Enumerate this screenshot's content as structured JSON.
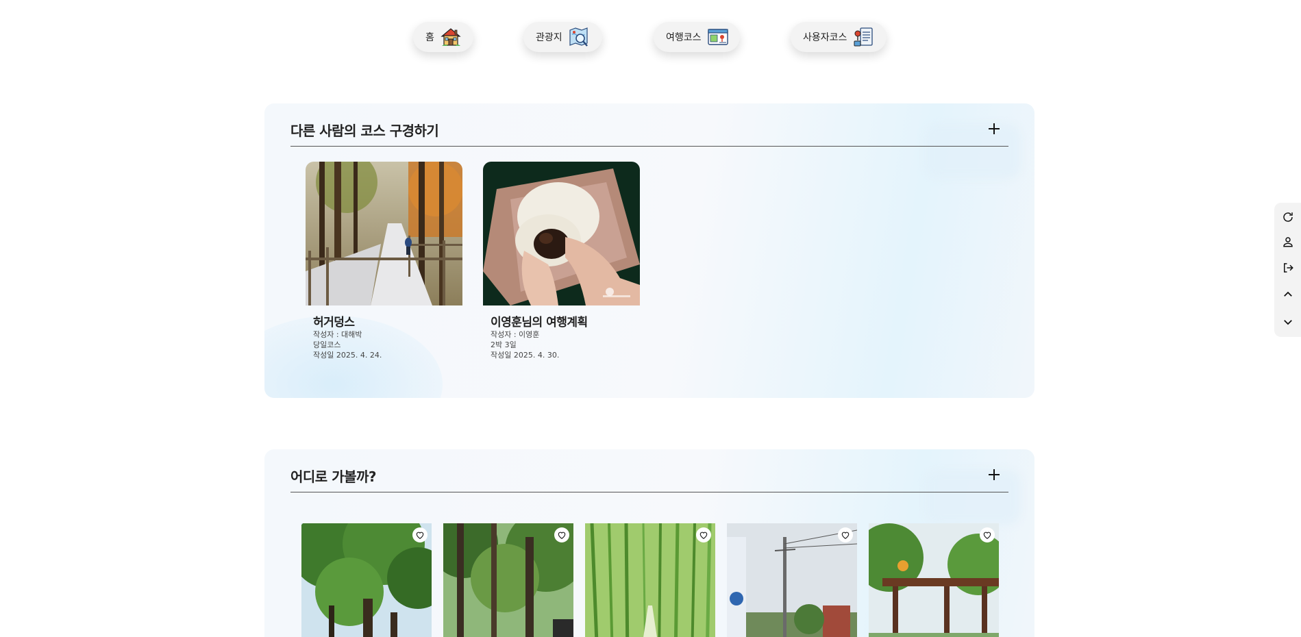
{
  "nav": {
    "items": [
      {
        "label": "홈",
        "icon": "house-icon"
      },
      {
        "label": "관광지",
        "icon": "map-search-icon"
      },
      {
        "label": "여행코스",
        "icon": "course-board-icon"
      },
      {
        "label": "사용자코스",
        "icon": "user-document-icon"
      }
    ]
  },
  "courses_section": {
    "title": "다른 사람의 코스 구경하기",
    "cards": [
      {
        "name": "허거덩스",
        "author": "작성자 : 대해박",
        "duration": "당일코스",
        "date": "작성일 2025. 4. 24.",
        "image": "autumn-forest-boardwalk"
      },
      {
        "name": "이영훈님의 여행계획",
        "author": "작성자 : 이영훈",
        "duration": "2박 3일",
        "date": "작성일 2025. 4. 30.",
        "image": "hands-holding-bun"
      }
    ]
  },
  "places_section": {
    "title": "어디로 가볼까?",
    "cards": [
      {
        "image": "tree-canopy"
      },
      {
        "image": "forest-path"
      },
      {
        "image": "bamboo-grove"
      },
      {
        "image": "street-utility-pole"
      },
      {
        "image": "park-pavilion"
      }
    ]
  },
  "sidebar": {
    "icons": [
      "refresh-icon",
      "user-icon",
      "logout-icon",
      "chevron-up-icon",
      "chevron-down-icon"
    ]
  },
  "colors": {
    "section_bg": "#f4f8fc",
    "section_accent": "#e4f4fc",
    "nav_pill_bg": "#f3f3f3"
  }
}
